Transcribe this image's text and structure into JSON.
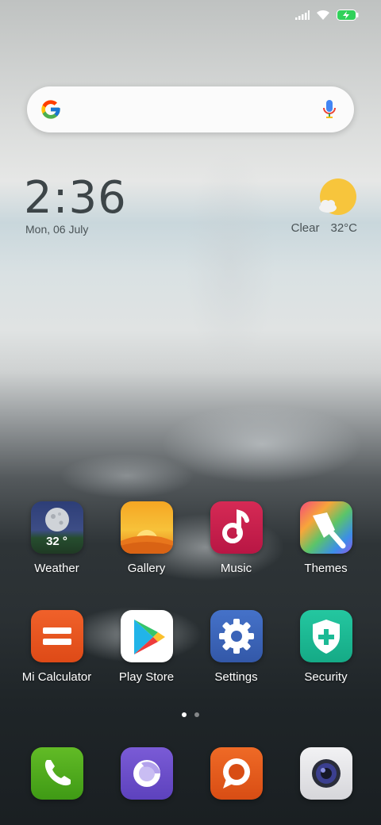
{
  "status_bar": {
    "icons": [
      "signal-icon",
      "wifi-icon",
      "battery-charging-icon"
    ]
  },
  "search_bar": {
    "logo": "google-logo",
    "mic": "mic-icon"
  },
  "clock_widget": {
    "time": "2:36",
    "date": "Mon, 06 July",
    "weather_condition": "Clear",
    "temperature": "32°C",
    "weather_icon": "sun-cloud-icon"
  },
  "weather_app_temp": "32 °",
  "apps_row1": [
    {
      "label": "Weather",
      "icon": "weather-icon"
    },
    {
      "label": "Gallery",
      "icon": "gallery-icon"
    },
    {
      "label": "Music",
      "icon": "music-icon"
    },
    {
      "label": "Themes",
      "icon": "themes-icon"
    }
  ],
  "apps_row2": [
    {
      "label": "Mi Calculator",
      "icon": "calculator-icon"
    },
    {
      "label": "Play Store",
      "icon": "play-store-icon"
    },
    {
      "label": "Settings",
      "icon": "settings-icon"
    },
    {
      "label": "Security",
      "icon": "security-icon"
    }
  ],
  "page_indicator": {
    "pages": 2,
    "current": 1
  },
  "dock": [
    {
      "icon": "phone-icon"
    },
    {
      "icon": "browser-icon"
    },
    {
      "icon": "messaging-icon"
    },
    {
      "icon": "camera-icon"
    }
  ],
  "colors": {
    "weather_bg": "#2e3f6e",
    "gallery_bg": "#f39a1c",
    "music_bg": "#c81e4a",
    "calculator_bg": "#e8541f",
    "settings_bg": "#3a63b8",
    "security_bg": "#1cba95",
    "phone_bg": "#4faa1c",
    "browser_bg": "#6a4fc9",
    "messaging_bg": "#e35a1c",
    "camera_bg": "#e8e8ea"
  }
}
